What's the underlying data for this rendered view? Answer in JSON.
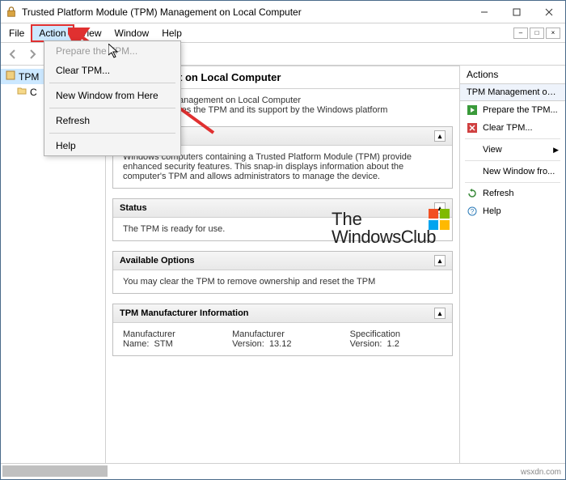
{
  "titlebar": {
    "title": "Trusted Platform Module (TPM) Management on Local Computer"
  },
  "menubar": {
    "file": "File",
    "action": "Action",
    "view": "View",
    "window": "Window",
    "help": "Help"
  },
  "dropdown": {
    "prepare": "Prepare the TPM...",
    "clear": "Clear TPM...",
    "newwin": "New Window from Here",
    "refresh": "Refresh",
    "help": "Help"
  },
  "tree": {
    "tpm": "TPM",
    "c": "C"
  },
  "center": {
    "header_suffix": "t on Local Computer",
    "sub1": "anagement on Local Computer",
    "sub2": "res the TPM and its support by the Windows platform",
    "overview_hdr": "",
    "overview_body": "Windows computers containing a Trusted Platform Module (TPM) provide enhanced security features. This snap-in displays information about the computer's TPM and allows administrators to manage the device.",
    "status_hdr": "Status",
    "status_body": "The TPM is ready for use.",
    "avail_hdr": "Available Options",
    "avail_body": "You may clear the TPM to remove ownership and reset the TPM",
    "mfg_hdr": "TPM Manufacturer Information",
    "mfg_name_l": "Manufacturer Name:",
    "mfg_name_v": "STM",
    "mfg_ver_l": "Manufacturer Version:",
    "mfg_ver_v": "13.12",
    "spec_l": "Specification Version:",
    "spec_v": "1.2"
  },
  "actions": {
    "title": "Actions",
    "subhdr": "TPM Management on ...",
    "prepare": "Prepare the TPM...",
    "clear": "Clear TPM...",
    "view": "View",
    "newwin": "New Window fro...",
    "refresh": "Refresh",
    "help": "Help"
  },
  "watermark": {
    "line1": "The",
    "line2": "WindowsClub"
  },
  "credit": "wsxdn.com"
}
